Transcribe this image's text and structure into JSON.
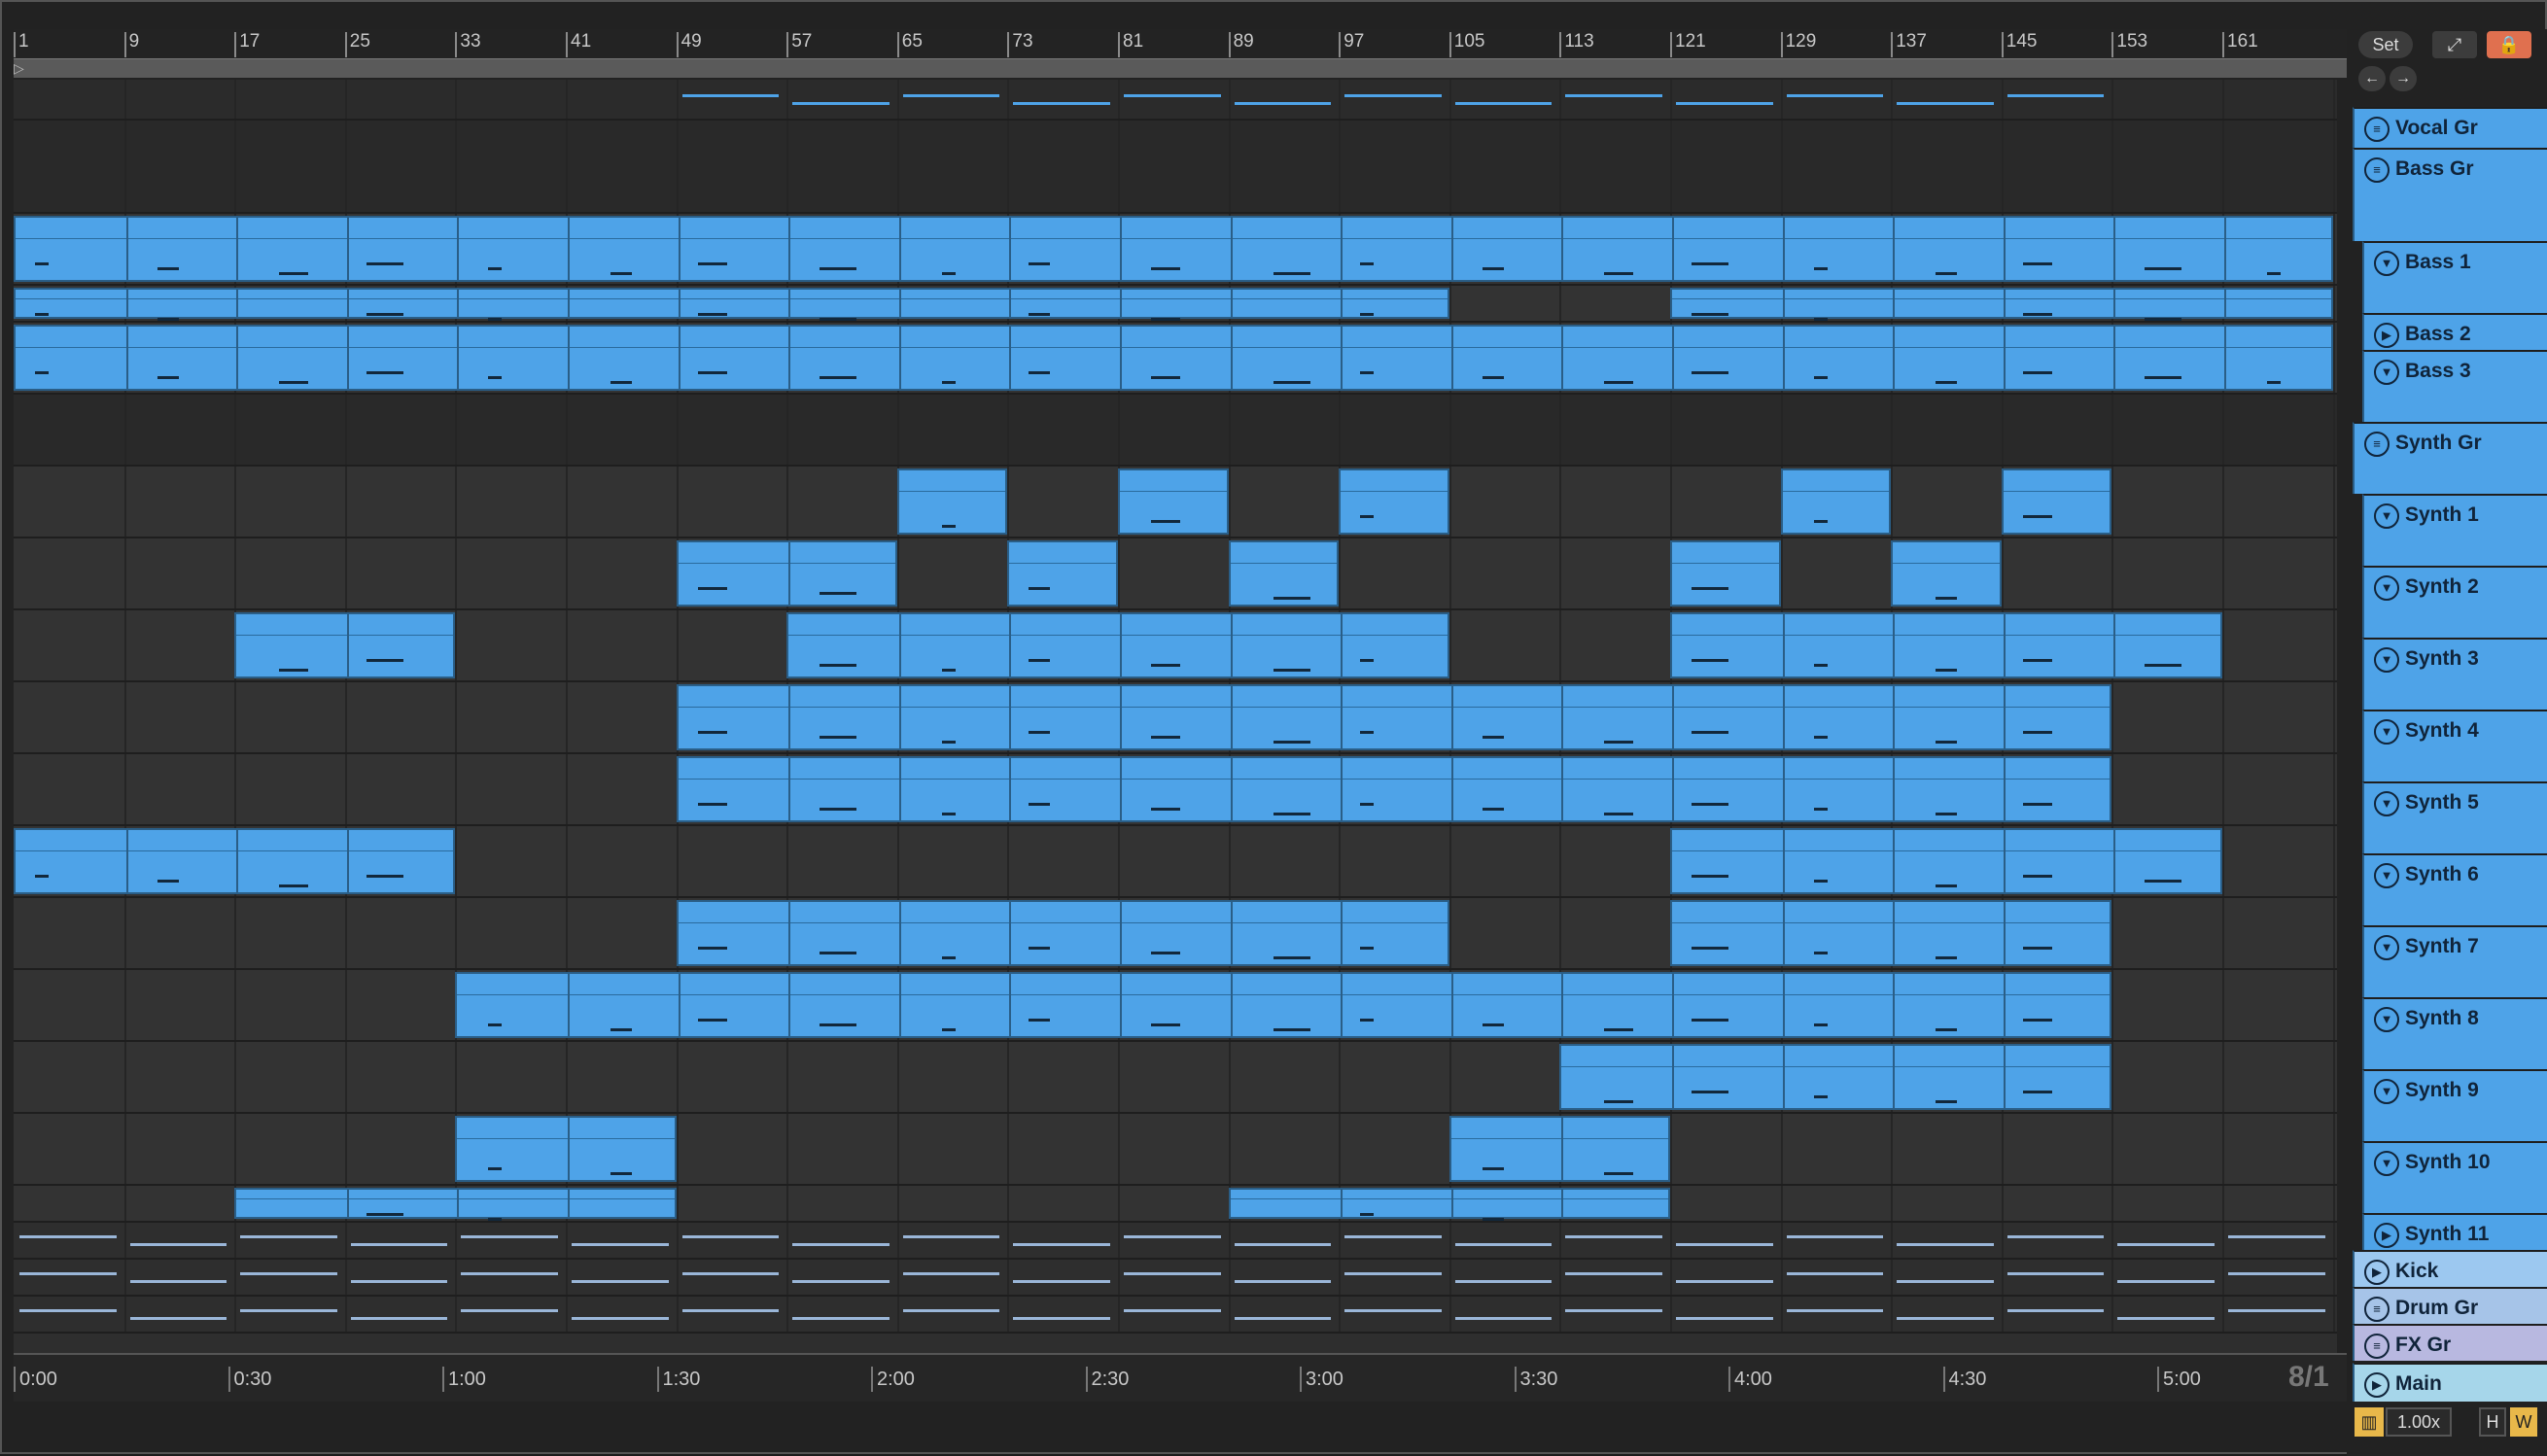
{
  "ruler": {
    "bars": [
      "1",
      "9",
      "17",
      "25",
      "33",
      "41",
      "49",
      "57",
      "65",
      "73",
      "81",
      "89",
      "97",
      "105",
      "113",
      "121",
      "129",
      "137",
      "145",
      "153",
      "161"
    ]
  },
  "timeline": {
    "times": [
      "0:00",
      "0:30",
      "1:00",
      "1:30",
      "2:00",
      "2:30",
      "3:00",
      "3:30",
      "4:00",
      "4:30",
      "5:00"
    ]
  },
  "controls": {
    "set_label": "Set",
    "expand_icon": "expand-icon",
    "lock_icon": "lock-icon",
    "nav_back_icon": "arrow-left-icon",
    "nav_forward_icon": "arrow-right-icon"
  },
  "tracks": [
    {
      "name": "Vocal Gr",
      "icon": "group-icon"
    },
    {
      "name": "Bass Gr",
      "icon": "group-icon"
    },
    {
      "name": "Bass 1",
      "icon": "fold-down-icon"
    },
    {
      "name": "Bass 2",
      "icon": "fold-right-icon"
    },
    {
      "name": "Bass 3",
      "icon": "fold-down-icon"
    },
    {
      "name": "Synth Gr",
      "icon": "group-icon"
    },
    {
      "name": "Synth 1",
      "icon": "fold-down-icon"
    },
    {
      "name": "Synth 2",
      "icon": "fold-down-icon"
    },
    {
      "name": "Synth 3",
      "icon": "fold-down-icon"
    },
    {
      "name": "Synth 4",
      "icon": "fold-down-icon"
    },
    {
      "name": "Synth 5",
      "icon": "fold-down-icon"
    },
    {
      "name": "Synth 6",
      "icon": "fold-down-icon"
    },
    {
      "name": "Synth 7",
      "icon": "fold-down-icon"
    },
    {
      "name": "Synth 8",
      "icon": "fold-down-icon"
    },
    {
      "name": "Synth 9",
      "icon": "fold-down-icon"
    },
    {
      "name": "Synth 10",
      "icon": "fold-down-icon"
    },
    {
      "name": "Synth 11",
      "icon": "fold-right-icon"
    },
    {
      "name": "Kick",
      "icon": "fold-right-icon"
    },
    {
      "name": "Drum Gr",
      "icon": "group-icon"
    },
    {
      "name": "FX Gr",
      "icon": "group-icon"
    }
  ],
  "main_track": {
    "name": "Main",
    "icon": "fold-right-icon"
  },
  "footer": {
    "time_signature": "8/1",
    "zoom": "1.00x",
    "h_label": "H",
    "w_label": "W"
  },
  "colors": {
    "clip": "#4ea3e8",
    "clip_border": "#2a5e87",
    "kick_header": "#9cc8f0",
    "drum_header": "#a6c4e8",
    "fx_header": "#b8b8e0",
    "main_header": "#a6d6ea",
    "lock_button": "#e0704f",
    "w_button": "#e8b84a"
  }
}
